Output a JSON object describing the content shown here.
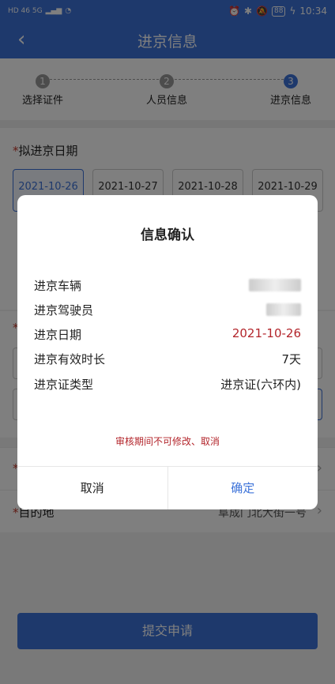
{
  "status_bar": {
    "network_left": "HD 46 5G",
    "battery": "88",
    "time": "10:34"
  },
  "header": {
    "back_icon": "chevron-left-icon",
    "title": "进京信息"
  },
  "steps": [
    {
      "num": "1",
      "label": "选择证件"
    },
    {
      "num": "2",
      "label": "人员信息"
    },
    {
      "num": "3",
      "label": "进京信息"
    }
  ],
  "date_section": {
    "required_mark": "*",
    "title": "拟进京日期",
    "dates": [
      "2021-10-26",
      "2021-10-27",
      "2021-10-28",
      "2021-10-29"
    ],
    "selected_index": 0
  },
  "background_form": {
    "req_mark": "*",
    "destination_label": "目的地",
    "destination_value": "阜成门北大街一号"
  },
  "submit_label": "提交申请",
  "dialog": {
    "title": "信息确认",
    "rows": [
      {
        "key": "进京车辆",
        "value": ""
      },
      {
        "key": "进京驾驶员",
        "value": ""
      },
      {
        "key": "进京日期",
        "value": "2021-10-26"
      },
      {
        "key": "进京有效时长",
        "value": "7天"
      },
      {
        "key": "进京证类型",
        "value": "进京证(六环内)"
      }
    ],
    "warning": "审核期间不可修改、取消",
    "cancel_label": "取消",
    "confirm_label": "确定"
  },
  "colors": {
    "primary": "#3d73d9",
    "danger": "#b3252b"
  }
}
